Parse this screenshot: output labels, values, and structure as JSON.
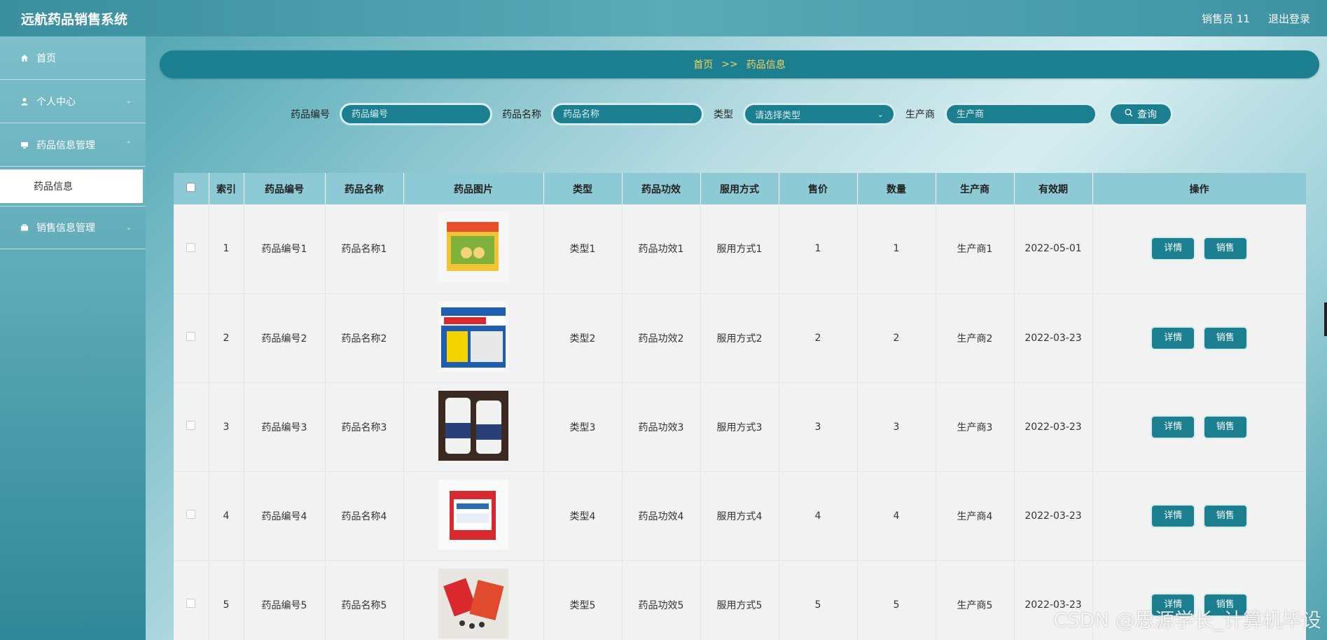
{
  "header": {
    "title": "远航药品销售系统",
    "user": "销售员 11",
    "logout": "退出登录"
  },
  "sidebar": {
    "items": [
      {
        "label": "首页"
      },
      {
        "label": "个人中心"
      },
      {
        "label": "药品信息管理"
      },
      {
        "label": "药品信息"
      },
      {
        "label": "销售信息管理"
      }
    ]
  },
  "breadcrumb": {
    "home": "首页",
    "sep": ">>",
    "current": "药品信息"
  },
  "search": {
    "code_label": "药品编号",
    "code_placeholder": "药品编号",
    "name_label": "药品名称",
    "name_placeholder": "药品名称",
    "type_label": "类型",
    "type_placeholder": "请选择类型",
    "maker_label": "生产商",
    "maker_placeholder": "生产商",
    "button": "查询"
  },
  "table": {
    "headers": [
      "索引",
      "药品编号",
      "药品名称",
      "药品图片",
      "类型",
      "药品功效",
      "服用方式",
      "售价",
      "数量",
      "生产商",
      "有效期",
      "操作"
    ],
    "rows": [
      {
        "index": "1",
        "code": "药品编号1",
        "name": "药品名称1",
        "type": "类型1",
        "effect": "药品功效1",
        "usage": "服用方式1",
        "price": "1",
        "qty": "1",
        "maker": "生产商1",
        "expiry": "2022-05-01"
      },
      {
        "index": "2",
        "code": "药品编号2",
        "name": "药品名称2",
        "type": "类型2",
        "effect": "药品功效2",
        "usage": "服用方式2",
        "price": "2",
        "qty": "2",
        "maker": "生产商2",
        "expiry": "2022-03-23"
      },
      {
        "index": "3",
        "code": "药品编号3",
        "name": "药品名称3",
        "type": "类型3",
        "effect": "药品功效3",
        "usage": "服用方式3",
        "price": "3",
        "qty": "3",
        "maker": "生产商3",
        "expiry": "2022-03-23"
      },
      {
        "index": "4",
        "code": "药品编号4",
        "name": "药品名称4",
        "type": "类型4",
        "effect": "药品功效4",
        "usage": "服用方式4",
        "price": "4",
        "qty": "4",
        "maker": "生产商4",
        "expiry": "2022-03-23"
      },
      {
        "index": "5",
        "code": "药品编号5",
        "name": "药品名称5",
        "type": "类型5",
        "effect": "药品功效5",
        "usage": "服用方式5",
        "price": "5",
        "qty": "5",
        "maker": "生产商5",
        "expiry": "2022-03-23"
      }
    ],
    "detail_label": "详情",
    "sell_label": "销售"
  },
  "watermark": "CSDN @思源学长_计算机毕设",
  "colors": {
    "accent": "#1b7f8f",
    "breadcrumb_text": "#f7d55b",
    "header_row": "#8ecad6"
  }
}
